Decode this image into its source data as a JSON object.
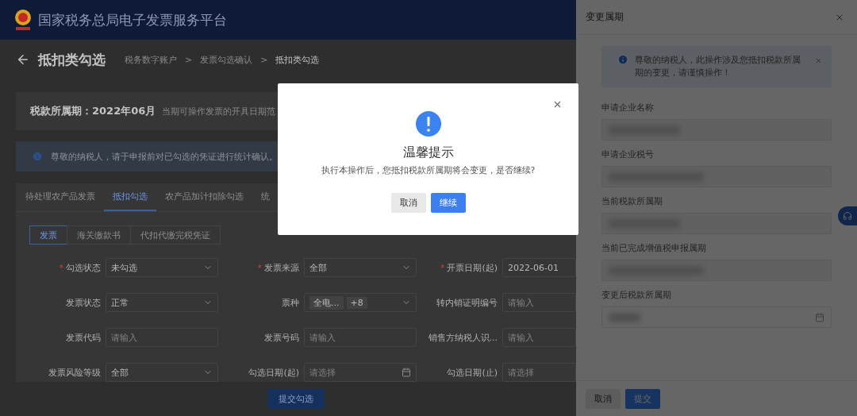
{
  "header": {
    "title": "国家税务总局电子发票服务平台"
  },
  "page": {
    "title": "抵扣类勾选",
    "separator": ">",
    "breadcrumb": [
      {
        "label": "税务数字账户",
        "current": false
      },
      {
        "label": "发票勾选确认",
        "current": false
      },
      {
        "label": "抵扣类勾选",
        "current": true
      }
    ]
  },
  "period": {
    "label": "税款所属期：2022年06月",
    "note": "当期可操作发票的开具日期范"
  },
  "notice": {
    "text": "尊敬的纳税人，请于申报前对已勾选的凭证进行统计确认。"
  },
  "tabs": [
    {
      "label": "待处理农产品发票",
      "selected": false
    },
    {
      "label": "抵扣勾选",
      "selected": true
    },
    {
      "label": "农产品加计扣除勾选",
      "selected": false
    },
    {
      "label": "统",
      "selected": false
    }
  ],
  "subtabs": [
    {
      "label": "发票",
      "selected": true
    },
    {
      "label": "海关缴款书",
      "selected": false
    },
    {
      "label": "代扣代缴完税凭证",
      "selected": false
    }
  ],
  "required_mark": "*",
  "filters": [
    {
      "label": "勾选状态",
      "required": true,
      "kind": "select",
      "value": "未勾选"
    },
    {
      "label": "发票来源",
      "required": true,
      "kind": "select",
      "value": "全部"
    },
    {
      "label": "开票日期(起)",
      "required": true,
      "kind": "input",
      "value": "2022-06-01"
    },
    {
      "label": "发票状态",
      "required": false,
      "kind": "select",
      "value": "正常"
    },
    {
      "label": "票种",
      "required": false,
      "kind": "tags",
      "tags": [
        "全电...",
        "+8"
      ]
    },
    {
      "label": "转内销证明编号",
      "required": false,
      "kind": "input",
      "placeholder": "请输入"
    },
    {
      "label": "发票代码",
      "required": false,
      "kind": "input",
      "placeholder": "请输入"
    },
    {
      "label": "发票号码",
      "required": false,
      "kind": "input",
      "placeholder": "请输入"
    },
    {
      "label": "销售方纳税人识...",
      "required": false,
      "kind": "input",
      "placeholder": "请输入"
    },
    {
      "label": "发票风险等级",
      "required": false,
      "kind": "select",
      "value": "全部"
    },
    {
      "label": "勾选日期(起)",
      "required": false,
      "kind": "date",
      "placeholder": "请选择"
    },
    {
      "label": "勾选日期(止)",
      "required": false,
      "kind": "input",
      "placeholder": "请选择"
    }
  ],
  "submit_button": "提交勾选",
  "drawer": {
    "title": "变更属期",
    "alert": "尊敬的纳税人，此操作涉及您抵扣税款所属期的变更，请谨慎操作！",
    "fields": [
      {
        "label": "申请企业名称",
        "kind": "text"
      },
      {
        "label": "申请企业税号",
        "kind": "text"
      },
      {
        "label": "当前税款所属期",
        "kind": "text"
      },
      {
        "label": "当前已完成增值税申报属期",
        "kind": "text"
      },
      {
        "label": "变更后税款所属期",
        "kind": "date"
      }
    ],
    "buttons": [
      {
        "label": "取消",
        "primary": false
      },
      {
        "label": "提交",
        "primary": true
      }
    ]
  },
  "dialog": {
    "title": "温馨提示",
    "message": "执行本操作后，您抵扣税款所属期将会变更，是否继续?",
    "buttons": [
      {
        "label": "取消",
        "primary": false
      },
      {
        "label": "继续",
        "primary": true
      }
    ]
  }
}
